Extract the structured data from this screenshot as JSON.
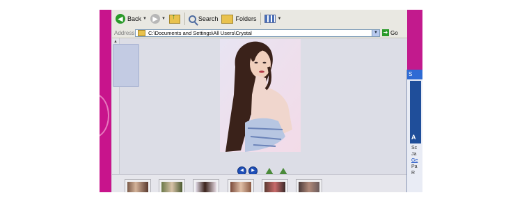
{
  "toolbar": {
    "back_label": "Back",
    "search_label": "Search",
    "folders_label": "Folders"
  },
  "address": {
    "label": "Address",
    "path": "C:\\Documents and Settings\\All Users\\Crystal",
    "go_label": "Go"
  },
  "side_panel": {
    "title_fragment": "S",
    "image_text_fragment": "A",
    "line1": "Sc",
    "line2": "Ja",
    "line3": "Ge",
    "line4": "Pa",
    "line5": "R"
  },
  "viewer_controls": [
    "previous-image",
    "next-image",
    "rotate-clockwise",
    "rotate-counterclockwise"
  ],
  "thumbnails_count": 6,
  "colors": {
    "desktop_magenta": "#c8148c",
    "toolbar_bg": "#e9e8e2",
    "content_bg": "#dcdde6",
    "nav_button": "#1f4fb8"
  }
}
